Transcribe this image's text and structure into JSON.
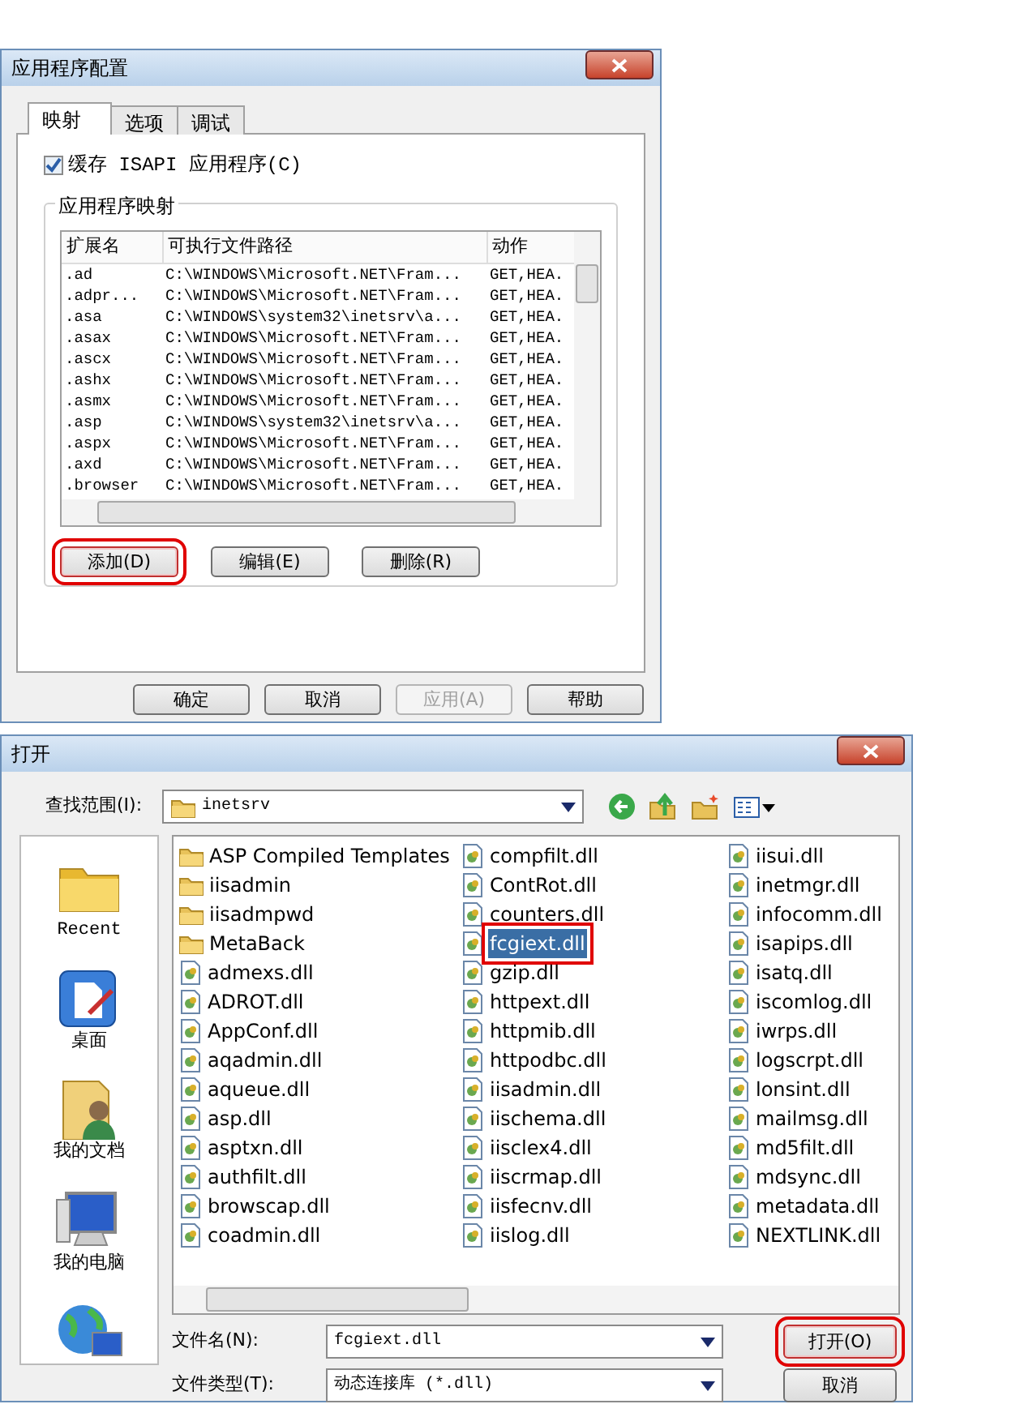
{
  "config_dialog": {
    "title": "应用程序配置",
    "tabs": [
      {
        "label": "映射",
        "selected": true
      },
      {
        "label": "选项",
        "selected": false
      },
      {
        "label": "调试",
        "selected": false
      }
    ],
    "cache_checkbox": {
      "label": "缓存 ISAPI 应用程序(C)",
      "checked": true
    },
    "group_title": "应用程序映射",
    "columns": [
      "扩展名",
      "可执行文件路径",
      "动作"
    ],
    "rows": [
      {
        "ext": ".ad",
        "path": "C:\\WINDOWS\\Microsoft.NET\\Fram...",
        "action": "GET,HEA."
      },
      {
        "ext": ".adpr...",
        "path": "C:\\WINDOWS\\Microsoft.NET\\Fram...",
        "action": "GET,HEA."
      },
      {
        "ext": ".asa",
        "path": "C:\\WINDOWS\\system32\\inetsrv\\a...",
        "action": "GET,HEA."
      },
      {
        "ext": ".asax",
        "path": "C:\\WINDOWS\\Microsoft.NET\\Fram...",
        "action": "GET,HEA."
      },
      {
        "ext": ".ascx",
        "path": "C:\\WINDOWS\\Microsoft.NET\\Fram...",
        "action": "GET,HEA."
      },
      {
        "ext": ".ashx",
        "path": "C:\\WINDOWS\\Microsoft.NET\\Fram...",
        "action": "GET,HEA."
      },
      {
        "ext": ".asmx",
        "path": "C:\\WINDOWS\\Microsoft.NET\\Fram...",
        "action": "GET,HEA."
      },
      {
        "ext": ".asp",
        "path": "C:\\WINDOWS\\system32\\inetsrv\\a...",
        "action": "GET,HEA."
      },
      {
        "ext": ".aspx",
        "path": "C:\\WINDOWS\\Microsoft.NET\\Fram...",
        "action": "GET,HEA."
      },
      {
        "ext": ".axd",
        "path": "C:\\WINDOWS\\Microsoft.NET\\Fram...",
        "action": "GET,HEA."
      },
      {
        "ext": ".browser",
        "path": "C:\\WINDOWS\\Microsoft.NET\\Fram...",
        "action": "GET,HEA."
      }
    ],
    "list_buttons": [
      {
        "label": "添加(D)",
        "highlighted": true
      },
      {
        "label": "编辑(E)",
        "highlighted": false
      },
      {
        "label": "删除(R)",
        "highlighted": false
      }
    ],
    "footer_buttons": [
      {
        "label": "确定",
        "disabled": false
      },
      {
        "label": "取消",
        "disabled": false
      },
      {
        "label": "应用(A)",
        "disabled": true
      },
      {
        "label": "帮助",
        "disabled": false
      }
    ]
  },
  "open_dialog": {
    "title": "打开",
    "look_in_label": "查找范围(I):",
    "look_in_value": "inetsrv",
    "places": [
      {
        "kind": "recent",
        "label": "Recent"
      },
      {
        "kind": "desktop",
        "label": "桌面"
      },
      {
        "kind": "documents",
        "label": "我的文档"
      },
      {
        "kind": "computer",
        "label": "我的电脑"
      },
      {
        "kind": "network"
      }
    ],
    "files": [
      {
        "name": "ASP Compiled Templates",
        "kind": "folder",
        "selected": false,
        "highlighted": false
      },
      {
        "name": "iisadmin",
        "kind": "folder",
        "selected": false,
        "highlighted": false
      },
      {
        "name": "iisadmpwd",
        "kind": "folder",
        "selected": false,
        "highlighted": false
      },
      {
        "name": "MetaBack",
        "kind": "folder",
        "selected": false,
        "highlighted": false
      },
      {
        "name": "admexs.dll",
        "kind": "dll",
        "selected": false,
        "highlighted": false
      },
      {
        "name": "ADROT.dll",
        "kind": "dll",
        "selected": false,
        "highlighted": false
      },
      {
        "name": "AppConf.dll",
        "kind": "dll",
        "selected": false,
        "highlighted": false
      },
      {
        "name": "aqadmin.dll",
        "kind": "dll",
        "selected": false,
        "highlighted": false
      },
      {
        "name": "aqueue.dll",
        "kind": "dll",
        "selected": false,
        "highlighted": false
      },
      {
        "name": "asp.dll",
        "kind": "dll",
        "selected": false,
        "highlighted": false
      },
      {
        "name": "asptxn.dll",
        "kind": "dll",
        "selected": false,
        "highlighted": false
      },
      {
        "name": "authfilt.dll",
        "kind": "dll",
        "selected": false,
        "highlighted": false
      },
      {
        "name": "browscap.dll",
        "kind": "dll",
        "selected": false,
        "highlighted": false
      },
      {
        "name": "coadmin.dll",
        "kind": "dll",
        "selected": false,
        "highlighted": false
      },
      {
        "name": "compfilt.dll",
        "kind": "dll",
        "selected": false,
        "highlighted": false
      },
      {
        "name": "ContRot.dll",
        "kind": "dll",
        "selected": false,
        "highlighted": false
      },
      {
        "name": "counters.dll",
        "kind": "dll",
        "selected": false,
        "highlighted": false
      },
      {
        "name": "fcgiext.dll",
        "kind": "dll",
        "selected": true,
        "highlighted": true
      },
      {
        "name": "gzip.dll",
        "kind": "dll",
        "selected": false,
        "highlighted": false
      },
      {
        "name": "httpext.dll",
        "kind": "dll",
        "selected": false,
        "highlighted": false
      },
      {
        "name": "httpmib.dll",
        "kind": "dll",
        "selected": false,
        "highlighted": false
      },
      {
        "name": "httpodbc.dll",
        "kind": "dll",
        "selected": false,
        "highlighted": false
      },
      {
        "name": "iisadmin.dll",
        "kind": "dll",
        "selected": false,
        "highlighted": false
      },
      {
        "name": "iischema.dll",
        "kind": "dll",
        "selected": false,
        "highlighted": false
      },
      {
        "name": "iisclex4.dll",
        "kind": "dll",
        "selected": false,
        "highlighted": false
      },
      {
        "name": "iiscrmap.dll",
        "kind": "dll",
        "selected": false,
        "highlighted": false
      },
      {
        "name": "iisfecnv.dll",
        "kind": "dll",
        "selected": false,
        "highlighted": false
      },
      {
        "name": "iislog.dll",
        "kind": "dll",
        "selected": false,
        "highlighted": false
      },
      {
        "name": "iisui.dll",
        "kind": "dll",
        "selected": false,
        "highlighted": false
      },
      {
        "name": "inetmgr.dll",
        "kind": "dll",
        "selected": false,
        "highlighted": false
      },
      {
        "name": "infocomm.dll",
        "kind": "dll",
        "selected": false,
        "highlighted": false
      },
      {
        "name": "isapips.dll",
        "kind": "dll",
        "selected": false,
        "highlighted": false
      },
      {
        "name": "isatq.dll",
        "kind": "dll",
        "selected": false,
        "highlighted": false
      },
      {
        "name": "iscomlog.dll",
        "kind": "dll",
        "selected": false,
        "highlighted": false
      },
      {
        "name": "iwrps.dll",
        "kind": "dll",
        "selected": false,
        "highlighted": false
      },
      {
        "name": "logscrpt.dll",
        "kind": "dll",
        "selected": false,
        "highlighted": false
      },
      {
        "name": "lonsint.dll",
        "kind": "dll",
        "selected": false,
        "highlighted": false
      },
      {
        "name": "mailmsg.dll",
        "kind": "dll",
        "selected": false,
        "highlighted": false
      },
      {
        "name": "md5filt.dll",
        "kind": "dll",
        "selected": false,
        "highlighted": false
      },
      {
        "name": "mdsync.dll",
        "kind": "dll",
        "selected": false,
        "highlighted": false
      },
      {
        "name": "metadata.dll",
        "kind": "dll",
        "selected": false,
        "highlighted": false
      },
      {
        "name": "NEXTLINK.dll",
        "kind": "dll",
        "selected": false,
        "highlighted": false
      }
    ],
    "file_name_label": "文件名(N):",
    "file_name_value": "fcgiext.dll",
    "file_type_label": "文件类型(T):",
    "file_type_value": "动态连接库 (*.dll)",
    "buttons": [
      {
        "label": "打开(O)",
        "highlighted": true
      },
      {
        "label": "取消",
        "highlighted": false
      }
    ]
  }
}
